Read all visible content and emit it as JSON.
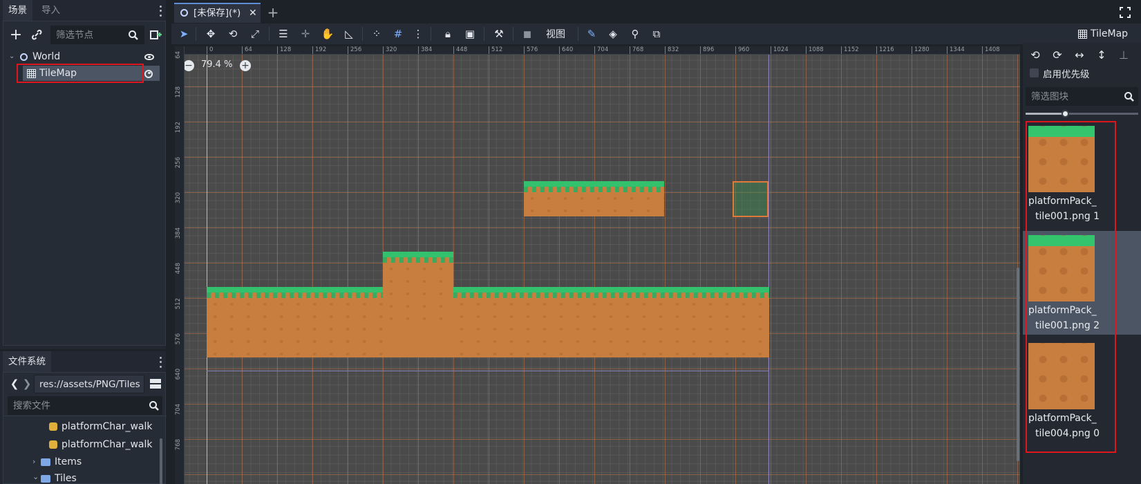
{
  "left_dock": {
    "tabs": [
      "场景",
      "导入"
    ],
    "filter_placeholder": "筛选节点",
    "tree": {
      "root": "World",
      "child": "TileMap"
    }
  },
  "filesystem": {
    "tab": "文件系统",
    "path": "res://assets/PNG/Tiles",
    "search_placeholder": "搜索文件",
    "items": [
      "platformChar_walk",
      "platformChar_walk",
      "Items",
      "Tiles"
    ]
  },
  "editor": {
    "scene_tab": "[未保存](*)",
    "view_menu": "视图",
    "zoom": "79.4 %",
    "node_label": "TileMap"
  },
  "ruler": {
    "h": [
      "0",
      "64",
      "128",
      "192",
      "256",
      "320",
      "384",
      "448",
      "512",
      "576",
      "640",
      "704",
      "768",
      "832",
      "896",
      "960",
      "1024",
      "1088",
      "1152",
      "1216",
      "1280",
      "1344",
      "1408"
    ],
    "v": [
      "64",
      "128",
      "192",
      "256",
      "320",
      "384",
      "448",
      "512",
      "576",
      "640",
      "704",
      "768"
    ]
  },
  "tile_panel": {
    "priority_label": "启用优先级",
    "filter_placeholder": "筛选图块",
    "tiles": [
      {
        "line1": "platformPack_",
        "line2": "tile001.png 1"
      },
      {
        "line1": "platformPack_",
        "line2": "tile001.png 2"
      },
      {
        "line1": "platformPack_",
        "line2": "tile004.png 0"
      }
    ]
  },
  "colors": {
    "accent": "#5f8fd6",
    "highlight_red": "#e0161e",
    "grass": "#34c16d",
    "dirt": "#c87e3f"
  }
}
